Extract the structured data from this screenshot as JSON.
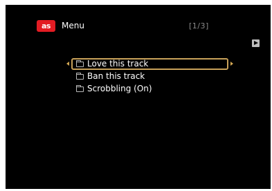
{
  "header": {
    "logo_text": "as",
    "title": "Menu",
    "pager": "[1/3]"
  },
  "menu": {
    "items": [
      {
        "label": "Love this track",
        "icon": "folder-icon",
        "selected": true
      },
      {
        "label": "Ban this track",
        "icon": "folder-icon",
        "selected": false
      },
      {
        "label": "Scrobbling (On)",
        "icon": "folder-icon",
        "selected": false
      }
    ]
  },
  "colors": {
    "background": "#000000",
    "logo": "#e31c23",
    "selection_border": "#c9a25a",
    "text": "#ffffff",
    "pager": "#8a8a8a"
  },
  "icons": {
    "logo": "lastfm-logo",
    "play": "play-icon",
    "left": "arrow-left-icon",
    "right": "arrow-right-icon"
  }
}
